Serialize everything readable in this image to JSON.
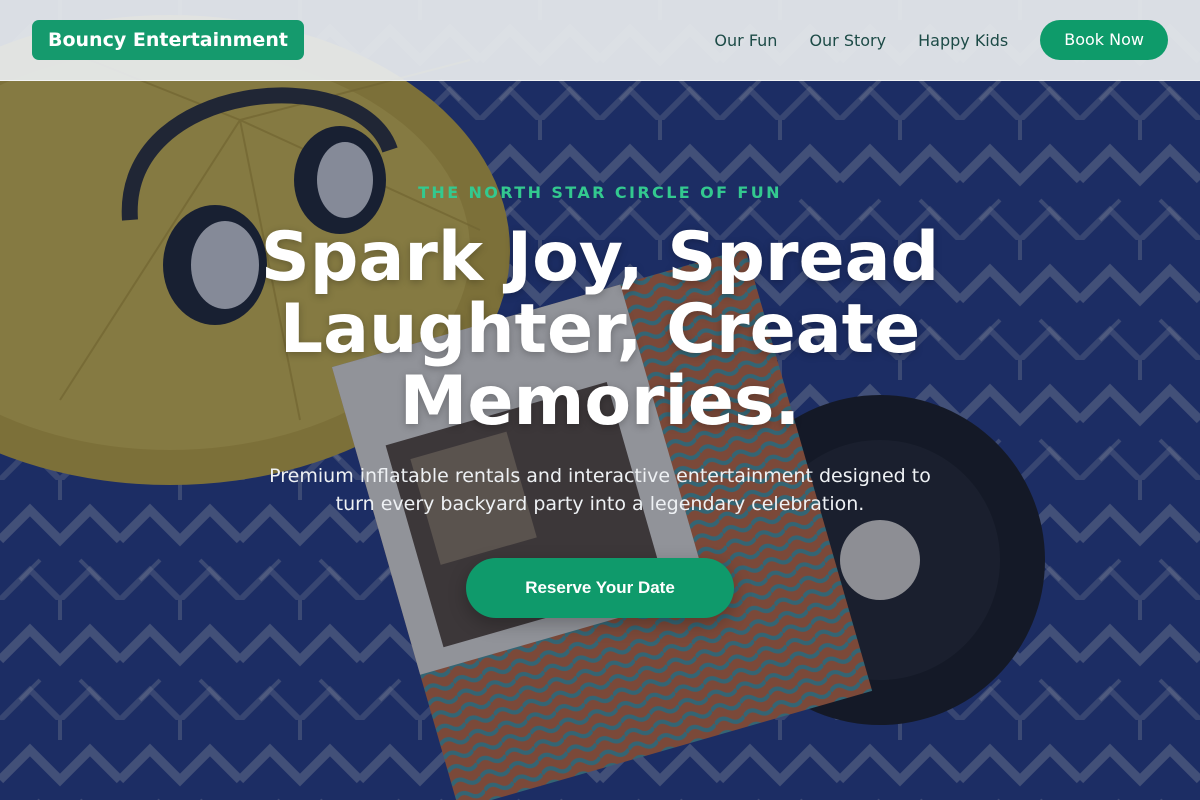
{
  "header": {
    "brand": "Bouncy Entertainment",
    "nav": [
      {
        "label": "Our Fun"
      },
      {
        "label": "Our Story"
      },
      {
        "label": "Happy Kids"
      }
    ],
    "cta_label": "Book Now"
  },
  "hero": {
    "eyebrow": "THE NORTH STAR CIRCLE OF FUN",
    "headline": "Spark Joy, Spread Laughter, Create Memories.",
    "subline": "Premium inflatable rentals and interactive entertainment designed to turn every backyard party into a legendary celebration.",
    "cta_label": "Reserve Your Date",
    "background_image": "headphones, yellow pouf, vinyl record and album sleeve on a blue patterned rug"
  },
  "colors": {
    "brand_green": "#159a6d",
    "eyebrow_green": "#33c98f",
    "nav_text": "#1d4b47",
    "headline": "#ffffff"
  }
}
